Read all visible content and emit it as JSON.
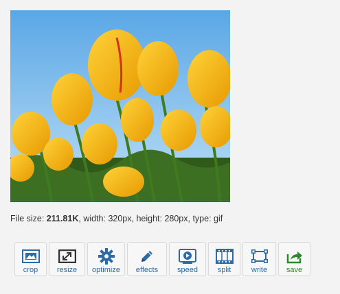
{
  "image": {
    "alt": ""
  },
  "file_info": {
    "size_label": "File size: ",
    "size_value": "211.81K",
    "dims_text": ", width: 320px, height: 280px, type: gif"
  },
  "toolbar": {
    "items": [
      {
        "id": "crop",
        "label": "crop",
        "icon": "crop-icon"
      },
      {
        "id": "resize",
        "label": "resize",
        "icon": "resize-icon"
      },
      {
        "id": "optimize",
        "label": "optimize",
        "icon": "gear-icon"
      },
      {
        "id": "effects",
        "label": "effects",
        "icon": "pencil-icon"
      },
      {
        "id": "speed",
        "label": "speed",
        "icon": "play-icon"
      },
      {
        "id": "split",
        "label": "split",
        "icon": "filmstrip-icon"
      },
      {
        "id": "write",
        "label": "write",
        "icon": "text-box-icon"
      },
      {
        "id": "save",
        "label": "save",
        "icon": "share-arrow-icon"
      }
    ]
  },
  "colors": {
    "accent_blue": "#2e6aa6",
    "save_green": "#2a8a2a",
    "sky": "#6fb0e0",
    "tulip_yellow": "#f4b400"
  }
}
